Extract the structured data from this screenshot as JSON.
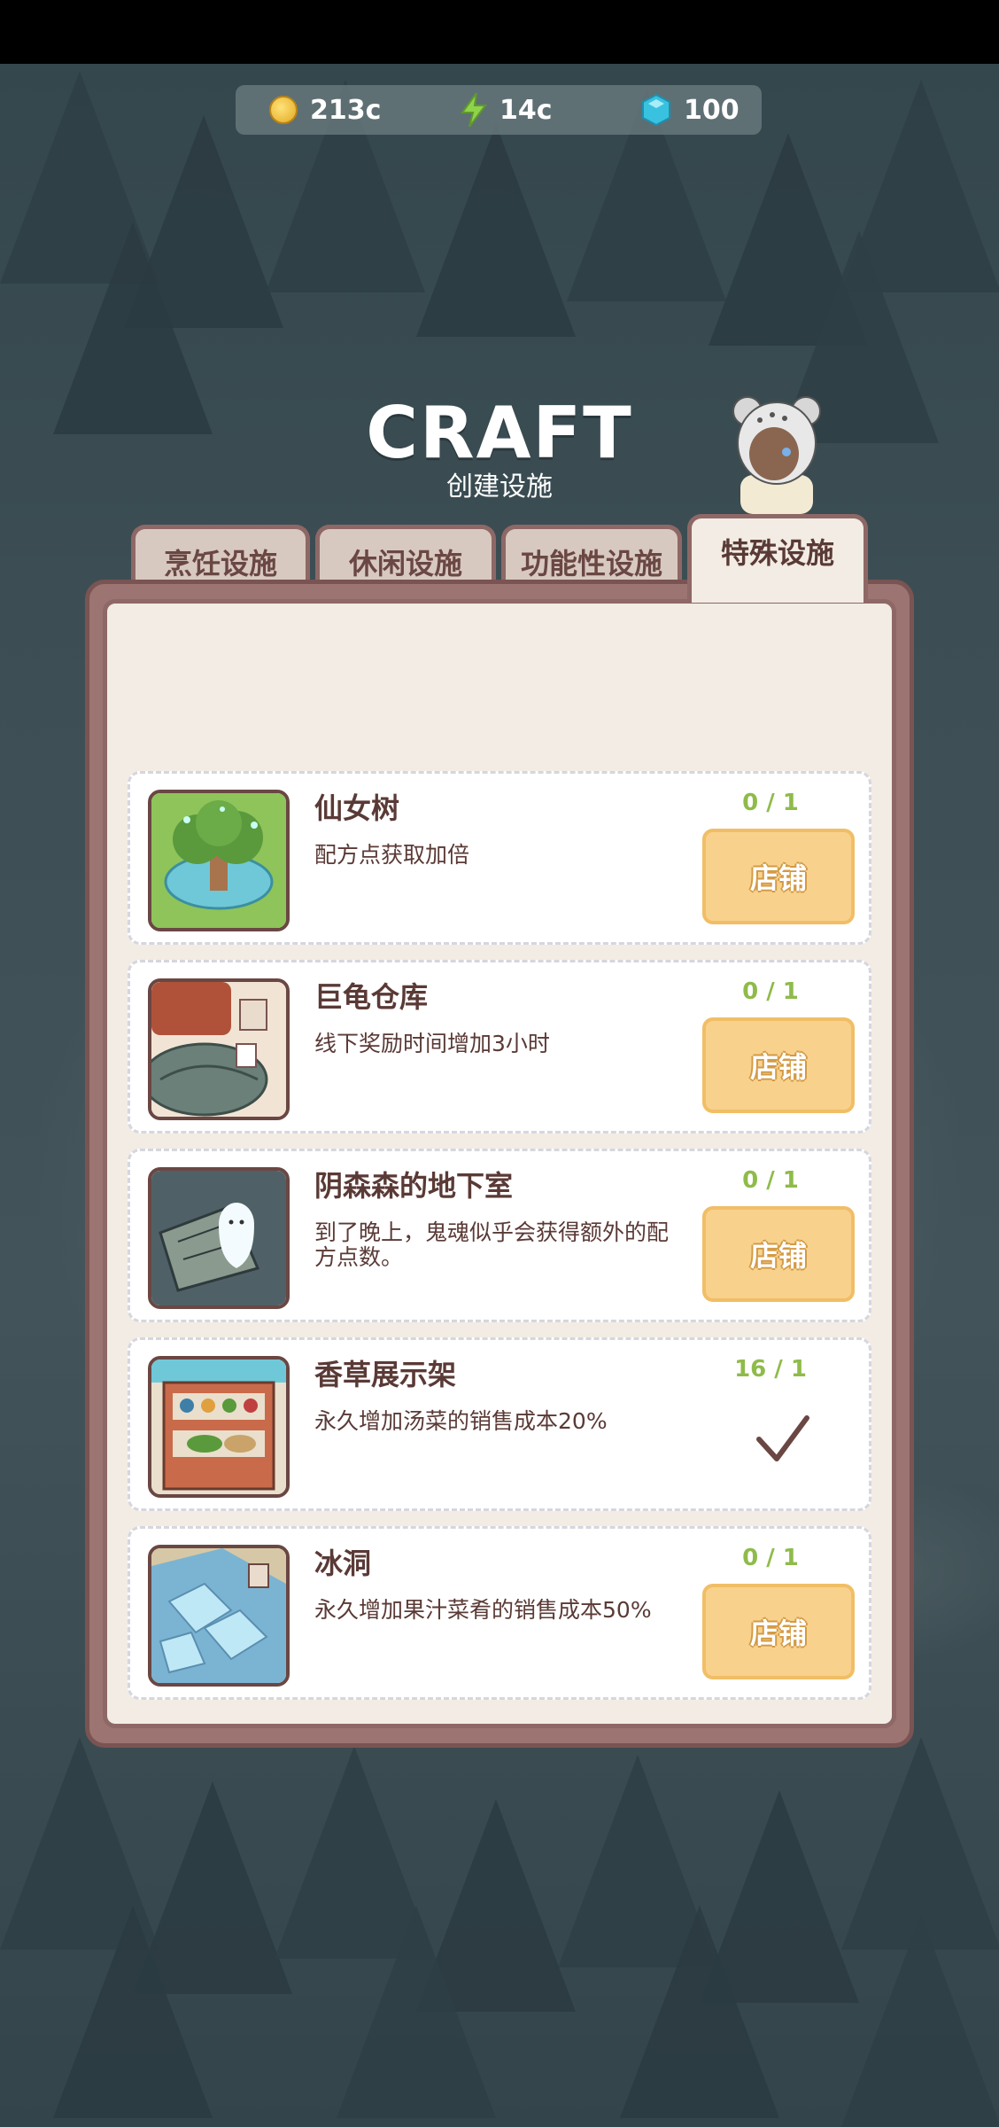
{
  "resources": {
    "coins": "213c",
    "energy": "14c",
    "gems": "100"
  },
  "title": "CRAFT",
  "subtitle": "创建设施",
  "tabs": [
    {
      "label": "烹饪设施",
      "active": false
    },
    {
      "label": "休闲设施",
      "active": false
    },
    {
      "label": "功能性设施",
      "active": false
    },
    {
      "label": "特殊设施",
      "active": true
    }
  ],
  "items": [
    {
      "name": "仙女树",
      "desc": "配方点获取加倍",
      "count": "0 / 1",
      "button": "店铺",
      "owned": false,
      "icon": "fairy-tree-icon"
    },
    {
      "name": "巨龟仓库",
      "desc": "线下奖励时间增加3小时",
      "count": "0 / 1",
      "button": "店铺",
      "owned": false,
      "icon": "giant-turtle-storage-icon"
    },
    {
      "name": "阴森森的地下室",
      "desc": "到了晚上，鬼魂似乎会获得额外的配方点数。",
      "count": "0 / 1",
      "button": "店铺",
      "owned": false,
      "icon": "ghost-basement-icon"
    },
    {
      "name": "香草展示架",
      "desc": "永久增加汤菜的销售成本20%",
      "count": "16 / 1",
      "button": "",
      "owned": true,
      "icon": "herb-display-shelf-icon"
    },
    {
      "name": "冰洞",
      "desc": "永久增加果汁菜肴的销售成本50%",
      "count": "0 / 1",
      "button": "店铺",
      "owned": false,
      "icon": "ice-cave-icon"
    }
  ],
  "colors": {
    "accent_green": "#8fbb4a",
    "button_fill": "#f8d28d",
    "panel_border": "#8e6866",
    "text_brown": "#5a3a36"
  }
}
